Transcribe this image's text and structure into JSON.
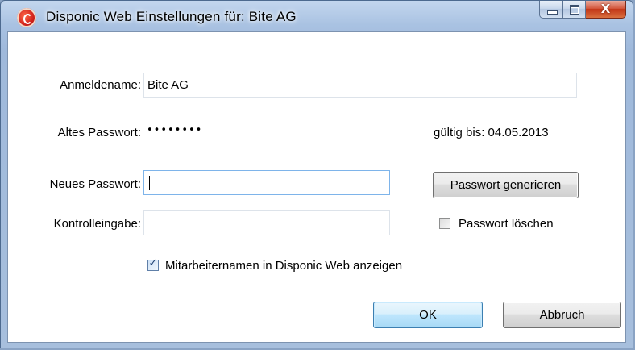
{
  "window": {
    "title": "Disponic Web Einstellungen für: Bite AG",
    "icon": "disponic-app-icon",
    "close_glyph": "X"
  },
  "form": {
    "login_label": "Anmeldename:",
    "login_value": "Bite AG",
    "old_password_label": "Altes Passwort:",
    "old_password_value": "••••••••",
    "valid_until": "gültig bis: 04.05.2013",
    "new_password_label": "Neues Passwort:",
    "new_password_value": "",
    "confirm_label": "Kontrolleingabe:",
    "confirm_value": "",
    "generate_button": "Passwort generieren",
    "delete_password_label": "Passwort löschen",
    "delete_password_checked": false,
    "show_names_label": "Mitarbeiternamen in Disponic Web anzeigen",
    "show_names_checked": true
  },
  "buttons": {
    "ok": "OK",
    "cancel": "Abbruch"
  },
  "colors": {
    "accent": "#3c7fb1",
    "close_button": "#c23517",
    "focus_border": "#7eb4ea"
  }
}
